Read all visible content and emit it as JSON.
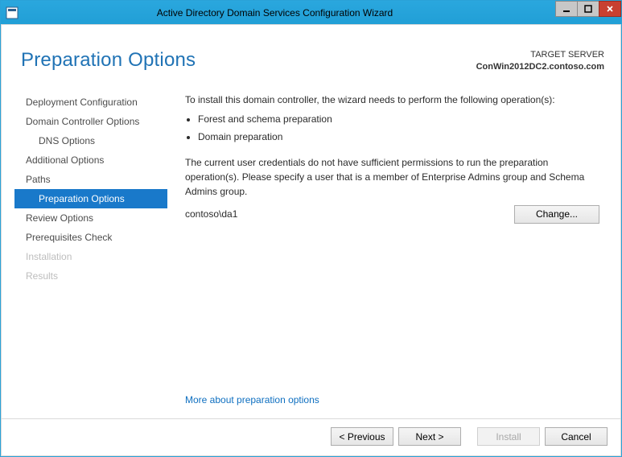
{
  "window": {
    "title": "Active Directory Domain Services Configuration Wizard"
  },
  "header": {
    "page_title": "Preparation Options",
    "target_label": "TARGET SERVER",
    "target_server": "ConWin2012DC2.contoso.com"
  },
  "sidebar": {
    "items": [
      {
        "label": "Deployment Configuration",
        "state": "normal"
      },
      {
        "label": "Domain Controller Options",
        "state": "normal"
      },
      {
        "label": "DNS Options",
        "state": "sub"
      },
      {
        "label": "Additional Options",
        "state": "normal"
      },
      {
        "label": "Paths",
        "state": "normal"
      },
      {
        "label": "Preparation Options",
        "state": "selected"
      },
      {
        "label": "Review Options",
        "state": "normal"
      },
      {
        "label": "Prerequisites Check",
        "state": "normal"
      },
      {
        "label": "Installation",
        "state": "disabled"
      },
      {
        "label": "Results",
        "state": "disabled"
      }
    ]
  },
  "content": {
    "intro": "To install this domain controller, the wizard needs to perform the following operation(s):",
    "bullets": [
      "Forest and schema preparation",
      "Domain preparation"
    ],
    "warning": "The current user credentials do not have sufficient permissions to run the preparation operation(s). Please specify a user that is a member of Enterprise Admins group and Schema Admins group.",
    "credential": "contoso\\da1",
    "change_button": "Change...",
    "more_link": "More about preparation options"
  },
  "footer": {
    "previous": "< Previous",
    "next": "Next >",
    "install": "Install",
    "cancel": "Cancel"
  }
}
